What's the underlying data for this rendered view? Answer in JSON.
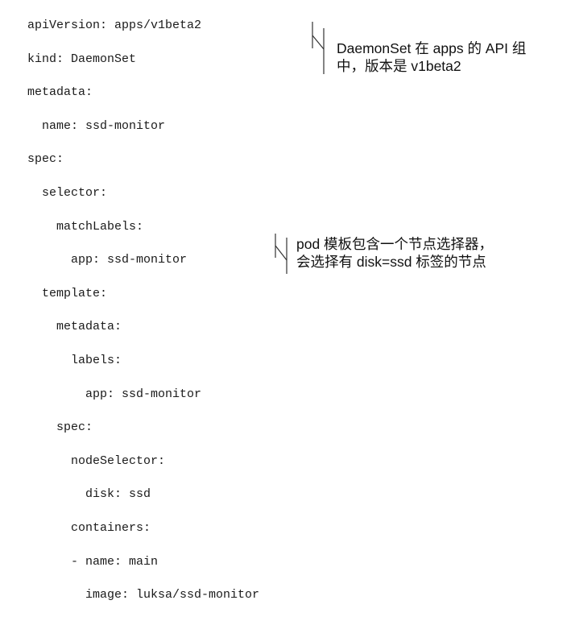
{
  "code_lines": [
    {
      "indent": 0,
      "text": "apiVersion: apps/v1beta2"
    },
    {
      "indent": 0,
      "text": "kind: DaemonSet"
    },
    {
      "indent": 0,
      "text": "metadata:"
    },
    {
      "indent": 1,
      "text": "name: ssd-monitor"
    },
    {
      "indent": 0,
      "text": "spec:"
    },
    {
      "indent": 1,
      "text": "selector:"
    },
    {
      "indent": 2,
      "text": "matchLabels:"
    },
    {
      "indent": 3,
      "text": "app: ssd-monitor"
    },
    {
      "indent": 1,
      "text": "template:"
    },
    {
      "indent": 2,
      "text": "metadata:"
    },
    {
      "indent": 3,
      "text": "labels:"
    },
    {
      "indent": 4,
      "text": "app: ssd-monitor"
    },
    {
      "indent": 2,
      "text": "spec:"
    },
    {
      "indent": 3,
      "text": "nodeSelector:"
    },
    {
      "indent": 4,
      "text": "disk: ssd"
    },
    {
      "indent": 3,
      "text": "containers:"
    },
    {
      "indent": 3,
      "text": "- name: main"
    },
    {
      "indent": 4,
      "text": "image: luksa/ssd-monitor"
    }
  ],
  "annotations": {
    "api_group": {
      "line1": "DaemonSet 在 apps 的 API 组",
      "line2": "中，版本是 v1beta2"
    },
    "node_selector": {
      "line1": "pod 模板包含一个节点选择器，",
      "line2": "会选择有 disk=ssd 标签的节点"
    }
  }
}
